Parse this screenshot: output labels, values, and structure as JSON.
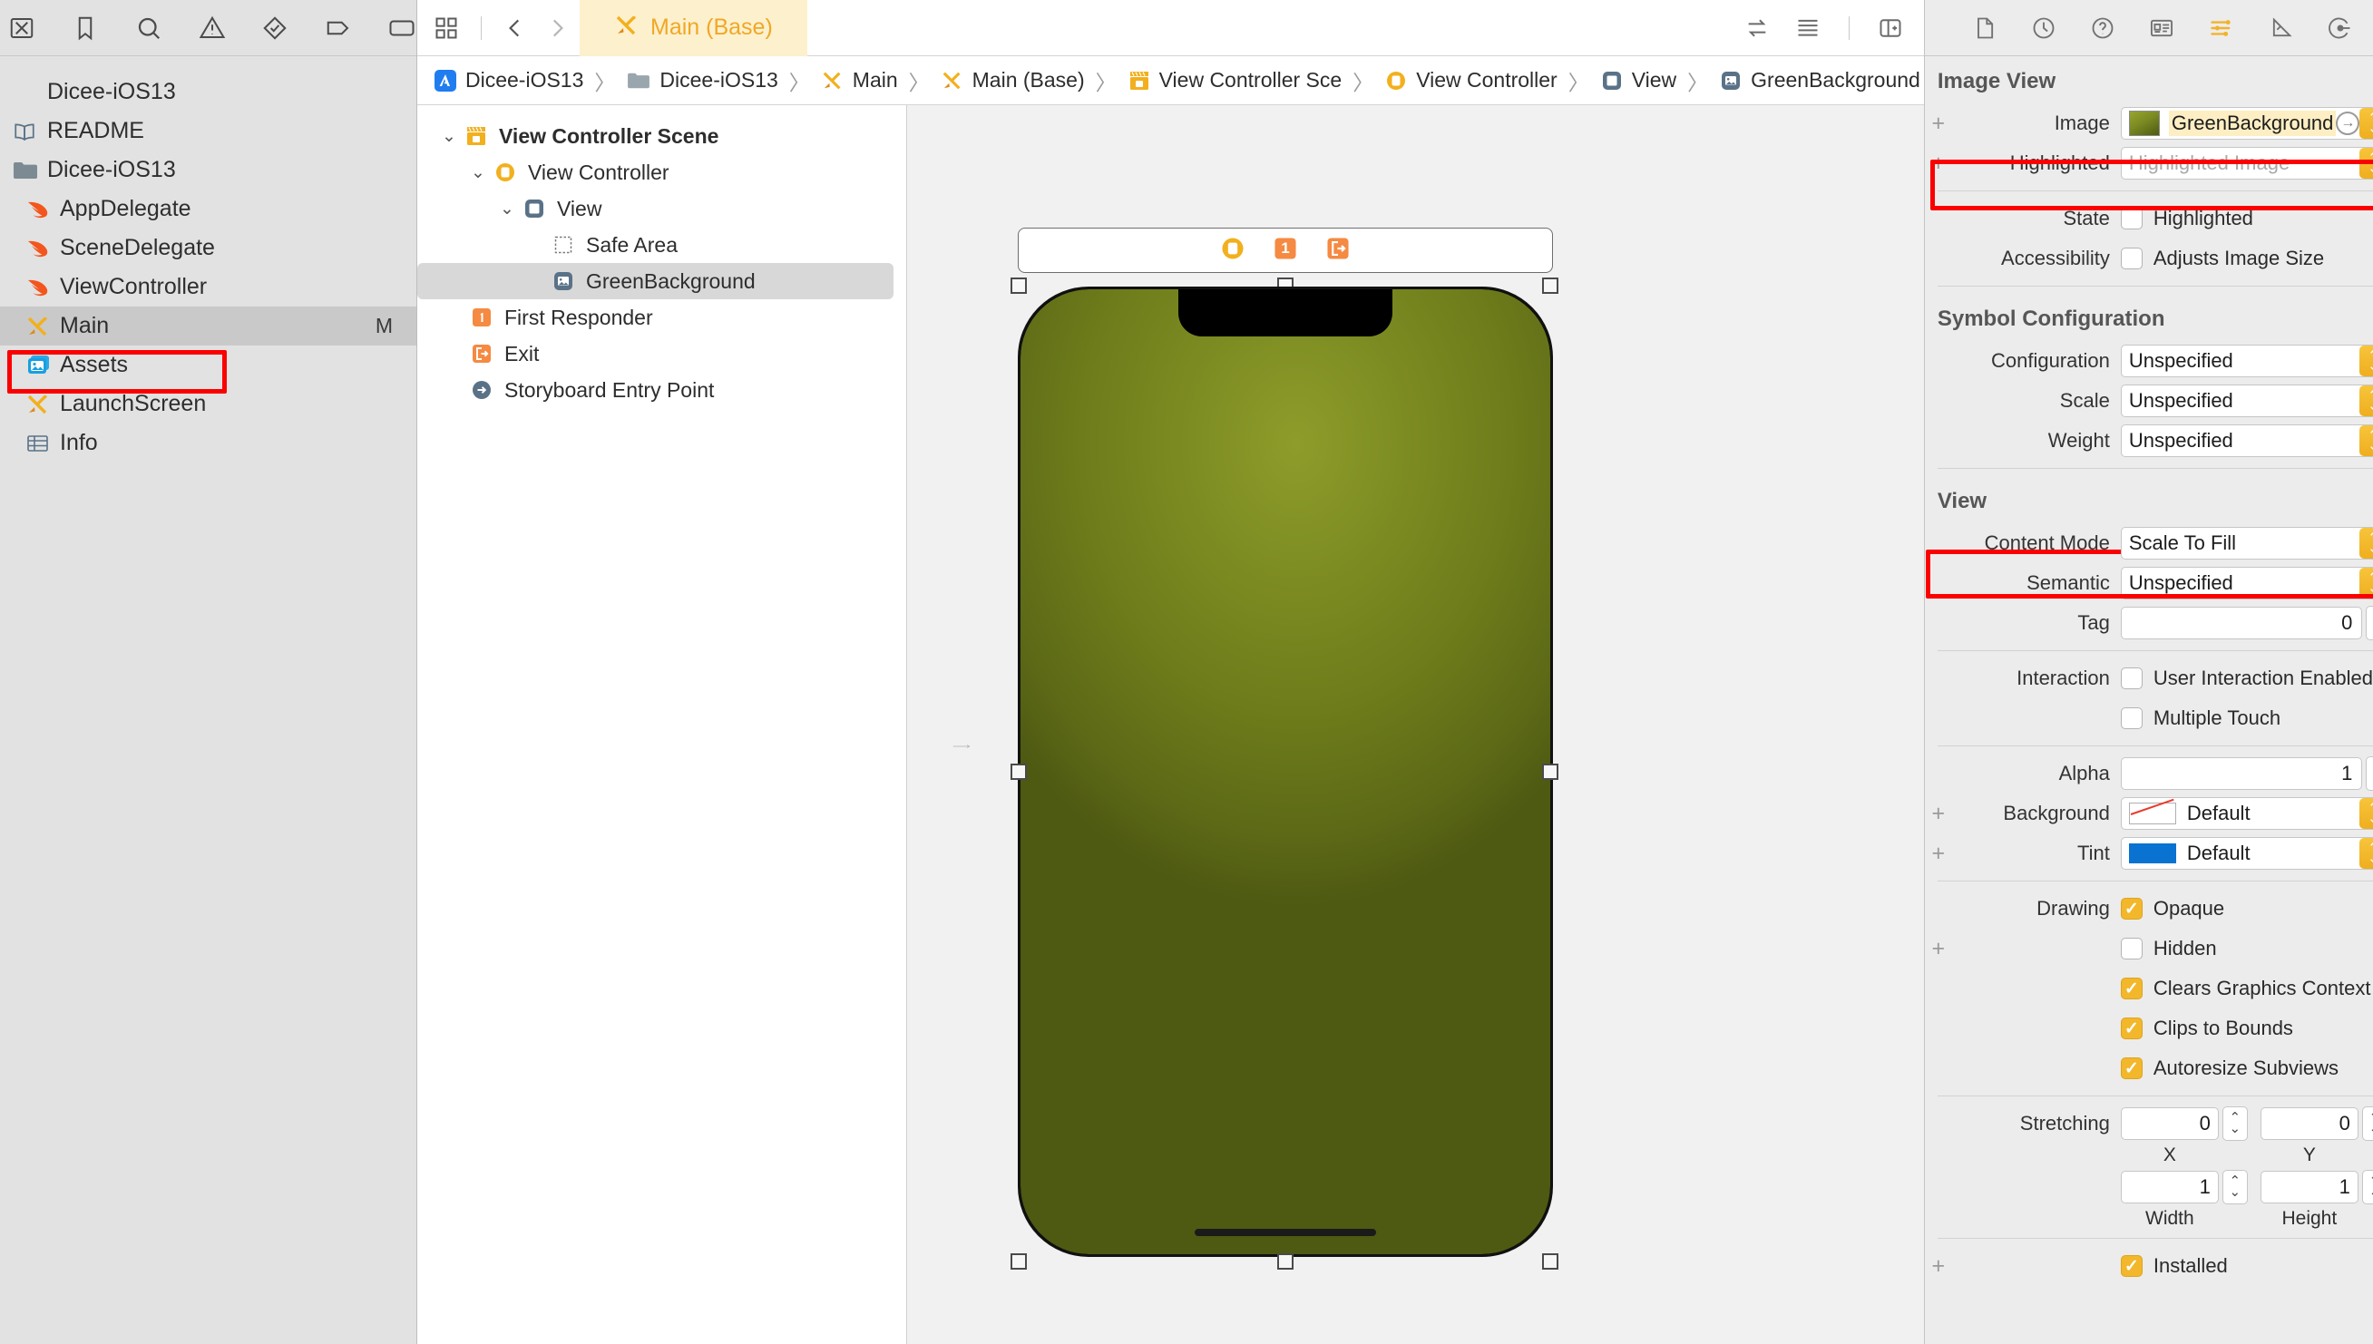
{
  "navigator": {
    "toolbar_icons": [
      "project-navigator-icon",
      "bookmark-icon",
      "search-icon",
      "warning-icon",
      "test-icon",
      "breakpoint-icon",
      "report-icon"
    ],
    "project_name": "Dicee-iOS13",
    "items": [
      {
        "label": "Dicee-iOS13",
        "icon": "none",
        "indent": 0,
        "selected": false,
        "badge": ""
      },
      {
        "label": "README",
        "icon": "readme-icon",
        "indent": 1,
        "selected": false,
        "badge": ""
      },
      {
        "label": "Dicee-iOS13",
        "icon": "folder-icon",
        "indent": 1,
        "selected": false,
        "badge": ""
      },
      {
        "label": "AppDelegate",
        "icon": "swift-icon",
        "indent": 2,
        "selected": false,
        "badge": ""
      },
      {
        "label": "SceneDelegate",
        "icon": "swift-icon",
        "indent": 2,
        "selected": false,
        "badge": ""
      },
      {
        "label": "ViewController",
        "icon": "swift-icon",
        "indent": 2,
        "selected": false,
        "badge": ""
      },
      {
        "label": "Main",
        "icon": "storyboard-icon",
        "indent": 2,
        "selected": true,
        "badge": "M"
      },
      {
        "label": "Assets",
        "icon": "assets-icon",
        "indent": 2,
        "selected": false,
        "badge": "",
        "annotated": true
      },
      {
        "label": "LaunchScreen",
        "icon": "storyboard-icon",
        "indent": 2,
        "selected": false,
        "badge": ""
      },
      {
        "label": "Info",
        "icon": "plist-icon",
        "indent": 2,
        "selected": false,
        "badge": ""
      }
    ]
  },
  "editor": {
    "toolbar": {
      "grid_icon": "grid-icon",
      "back_icon": "chevron-left-icon",
      "forward_icon": "chevron-right-icon",
      "tab_label": "Main (Base)",
      "tab_icon": "storyboard-icon",
      "right_icons": [
        "assistant-editor-icon",
        "minimap-icon",
        "add-editor-icon"
      ]
    },
    "breadcrumb": [
      {
        "label": "Dicee-iOS13",
        "icon": "xcode-project-icon"
      },
      {
        "label": "Dicee-iOS13",
        "icon": "folder-icon"
      },
      {
        "label": "Main",
        "icon": "storyboard-icon"
      },
      {
        "label": "Main (Base)",
        "icon": "storyboard-icon"
      },
      {
        "label": "View Controller Sce",
        "icon": "scene-icon"
      },
      {
        "label": "View Controller",
        "icon": "view-controller-icon"
      },
      {
        "label": "View",
        "icon": "view-icon"
      },
      {
        "label": "GreenBackground",
        "icon": "image-view-icon"
      }
    ],
    "separator": "〉"
  },
  "outline": [
    {
      "label": "View Controller Scene",
      "icon": "scene-icon",
      "indent": 0,
      "chevron": "down",
      "bold": true,
      "selected": false
    },
    {
      "label": "View Controller",
      "icon": "view-controller-icon",
      "indent": 1,
      "chevron": "down",
      "bold": false,
      "selected": false
    },
    {
      "label": "View",
      "icon": "view-icon",
      "indent": 2,
      "chevron": "down",
      "bold": false,
      "selected": false
    },
    {
      "label": "Safe Area",
      "icon": "safe-area-icon",
      "indent": 3,
      "chevron": "",
      "bold": false,
      "selected": false
    },
    {
      "label": "GreenBackground",
      "icon": "image-view-icon",
      "indent": 3,
      "chevron": "",
      "bold": false,
      "selected": true
    },
    {
      "label": "First Responder",
      "icon": "first-responder-icon",
      "indent": 1,
      "chevron": "",
      "bold": false,
      "selected": false
    },
    {
      "label": "Exit",
      "icon": "exit-icon",
      "indent": 1,
      "chevron": "",
      "bold": false,
      "selected": false
    },
    {
      "label": "Storyboard Entry Point",
      "icon": "entry-point-icon",
      "indent": 1,
      "chevron": "",
      "bold": false,
      "selected": false
    }
  ],
  "canvas": {
    "dock_icons": [
      "view-controller-icon",
      "first-responder-icon",
      "exit-icon"
    ],
    "first_responder_badge": "1",
    "background_gradient_center": "#8e9c2b",
    "background_gradient_edge": "#4e5912"
  },
  "inspector": {
    "toolbar_icons": [
      "file-inspector-icon",
      "history-inspector-icon",
      "help-inspector-icon",
      "identity-inspector-icon",
      "attributes-inspector-icon",
      "size-inspector-icon",
      "connections-inspector-icon"
    ],
    "active_toolbar_icon": "attributes-inspector-icon",
    "sections": {
      "image_view": {
        "title": "Image View",
        "image_label": "Image",
        "image_value": "GreenBackground",
        "highlighted_label": "Highlighted",
        "highlighted_placeholder": "Highlighted Image",
        "state_label": "State",
        "state_checkbox": "Highlighted",
        "state_checked": false,
        "accessibility_label": "Accessibility",
        "accessibility_checkbox": "Adjusts Image Size",
        "accessibility_checked": false
      },
      "symbol_configuration": {
        "title": "Symbol Configuration",
        "rows": [
          {
            "label": "Configuration",
            "value": "Unspecified"
          },
          {
            "label": "Scale",
            "value": "Unspecified"
          },
          {
            "label": "Weight",
            "value": "Unspecified"
          }
        ]
      },
      "view": {
        "title": "View",
        "content_mode_label": "Content Mode",
        "content_mode_value": "Scale To Fill",
        "semantic_label": "Semantic",
        "semantic_value": "Unspecified",
        "tag_label": "Tag",
        "tag_value": "0",
        "interaction_label": "Interaction",
        "interaction_items": [
          {
            "label": "User Interaction Enabled",
            "checked": false
          },
          {
            "label": "Multiple Touch",
            "checked": false
          }
        ],
        "alpha_label": "Alpha",
        "alpha_value": "1",
        "background_label": "Background",
        "background_value": "Default",
        "tint_label": "Tint",
        "tint_value": "Default",
        "drawing_label": "Drawing",
        "drawing_items": [
          {
            "label": "Opaque",
            "checked": true
          },
          {
            "label": "Hidden",
            "checked": false
          },
          {
            "label": "Clears Graphics Context",
            "checked": true
          },
          {
            "label": "Clips to Bounds",
            "checked": true
          },
          {
            "label": "Autoresize Subviews",
            "checked": true
          }
        ],
        "stretching_label": "Stretching",
        "stretching_x": "0",
        "stretching_y": "0",
        "stretching_x_sub": "X",
        "stretching_y_sub": "Y",
        "stretching_w": "1",
        "stretching_h": "1",
        "stretching_w_sub": "Width",
        "stretching_h_sub": "Height",
        "installed_label": "Installed",
        "installed_checked": true
      }
    }
  },
  "annotations": {
    "highlight_color": "#fb0000",
    "boxes": [
      "assets-sidebar-item",
      "image-field-row",
      "content-mode-row"
    ]
  }
}
